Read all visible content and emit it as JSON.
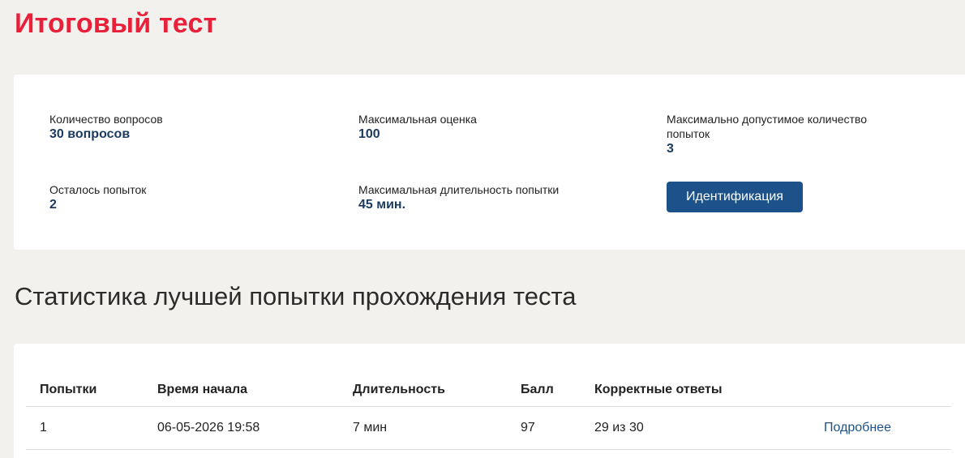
{
  "page": {
    "title": "Итоговый тест"
  },
  "info": {
    "questions_count": {
      "label": "Количество вопросов",
      "value": "30 вопросов"
    },
    "max_score": {
      "label": "Максимальная оценка",
      "value": "100"
    },
    "max_attempts": {
      "label": "Максимально допустимое количество попыток",
      "value": "3"
    },
    "attempts_left": {
      "label": "Осталось попыток",
      "value": "2"
    },
    "max_duration": {
      "label": "Максимальная длительность попытки",
      "value": "45 мин."
    },
    "ident_button_label": "Идентификация"
  },
  "stats": {
    "title": "Статистика лучшей попытки прохождения теста",
    "columns": [
      "Попытки",
      "Время начала",
      "Длительность",
      "Балл",
      "Корректные ответы"
    ],
    "rows": [
      {
        "attempt": "1",
        "start_time": "06-05-2026 19:58",
        "duration": "7 мин",
        "score": "97",
        "correct": "29 из 30",
        "details_label": "Подробнее"
      }
    ]
  }
}
